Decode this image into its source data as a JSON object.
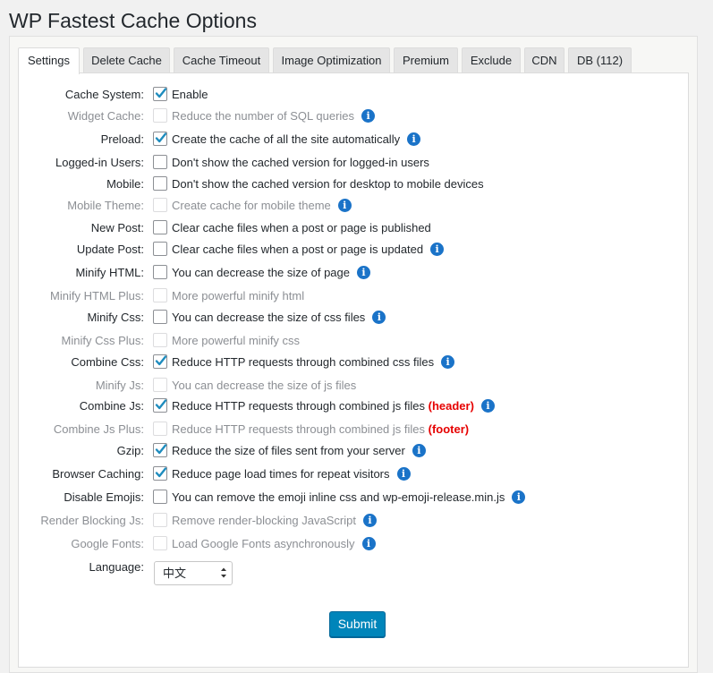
{
  "page": {
    "title": "WP Fastest Cache Options"
  },
  "tabs": [
    {
      "label": "Settings",
      "active": true
    },
    {
      "label": "Delete Cache",
      "active": false
    },
    {
      "label": "Cache Timeout",
      "active": false
    },
    {
      "label": "Image Optimization",
      "active": false
    },
    {
      "label": "Premium",
      "active": false
    },
    {
      "label": "Exclude",
      "active": false
    },
    {
      "label": "CDN",
      "active": false
    },
    {
      "label": "DB (112)",
      "active": false
    }
  ],
  "settings": [
    {
      "label": "Cache System:",
      "text": "Enable",
      "checked": true,
      "disabled": false,
      "info": false,
      "tag": ""
    },
    {
      "label": "Widget Cache:",
      "text": "Reduce the number of SQL queries",
      "checked": false,
      "disabled": true,
      "info": true,
      "tag": ""
    },
    {
      "label": "Preload:",
      "text": "Create the cache of all the site automatically",
      "checked": true,
      "disabled": false,
      "info": true,
      "tag": ""
    },
    {
      "label": "Logged-in Users:",
      "text": "Don't show the cached version for logged-in users",
      "checked": false,
      "disabled": false,
      "info": false,
      "tag": ""
    },
    {
      "label": "Mobile:",
      "text": "Don't show the cached version for desktop to mobile devices",
      "checked": false,
      "disabled": false,
      "info": false,
      "tag": ""
    },
    {
      "label": "Mobile Theme:",
      "text": "Create cache for mobile theme",
      "checked": false,
      "disabled": true,
      "info": true,
      "tag": ""
    },
    {
      "label": "New Post:",
      "text": "Clear cache files when a post or page is published",
      "checked": false,
      "disabled": false,
      "info": false,
      "tag": ""
    },
    {
      "label": "Update Post:",
      "text": "Clear cache files when a post or page is updated",
      "checked": false,
      "disabled": false,
      "info": true,
      "tag": ""
    },
    {
      "label": "Minify HTML:",
      "text": "You can decrease the size of page",
      "checked": false,
      "disabled": false,
      "info": true,
      "tag": ""
    },
    {
      "label": "Minify HTML Plus:",
      "text": "More powerful minify html",
      "checked": false,
      "disabled": true,
      "info": false,
      "tag": ""
    },
    {
      "label": "Minify Css:",
      "text": "You can decrease the size of css files",
      "checked": false,
      "disabled": false,
      "info": true,
      "tag": ""
    },
    {
      "label": "Minify Css Plus:",
      "text": "More powerful minify css",
      "checked": false,
      "disabled": true,
      "info": false,
      "tag": ""
    },
    {
      "label": "Combine Css:",
      "text": "Reduce HTTP requests through combined css files",
      "checked": true,
      "disabled": false,
      "info": true,
      "tag": ""
    },
    {
      "label": "Minify Js:",
      "text": "You can decrease the size of js files",
      "checked": false,
      "disabled": true,
      "info": false,
      "tag": ""
    },
    {
      "label": "Combine Js:",
      "text": "Reduce HTTP requests through combined js files",
      "checked": true,
      "disabled": false,
      "info": true,
      "tag": "(header)"
    },
    {
      "label": "Combine Js Plus:",
      "text": "Reduce HTTP requests through combined js files",
      "checked": false,
      "disabled": true,
      "info": false,
      "tag": "(footer)"
    },
    {
      "label": "Gzip:",
      "text": "Reduce the size of files sent from your server",
      "checked": true,
      "disabled": false,
      "info": true,
      "tag": ""
    },
    {
      "label": "Browser Caching:",
      "text": "Reduce page load times for repeat visitors",
      "checked": true,
      "disabled": false,
      "info": true,
      "tag": ""
    },
    {
      "label": "Disable Emojis:",
      "text": "You can remove the emoji inline css and wp-emoji-release.min.js",
      "checked": false,
      "disabled": false,
      "info": true,
      "tag": ""
    },
    {
      "label": "Render Blocking Js:",
      "text": "Remove render-blocking JavaScript",
      "checked": false,
      "disabled": true,
      "info": true,
      "tag": ""
    },
    {
      "label": "Google Fonts:",
      "text": "Load Google Fonts asynchronously",
      "checked": false,
      "disabled": true,
      "info": true,
      "tag": ""
    }
  ],
  "language": {
    "label": "Language:",
    "value": "中文"
  },
  "submit_label": "Submit",
  "colors": {
    "accent": "#0085ba",
    "info": "#1a73c8",
    "tag": "#e60000"
  },
  "icons": {
    "info": "info-icon",
    "check": "checkmark-icon",
    "select_arrows": "select-arrows-icon"
  }
}
